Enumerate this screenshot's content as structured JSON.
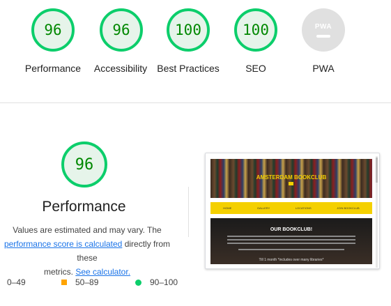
{
  "categories": [
    {
      "score": "96",
      "label": "Performance"
    },
    {
      "score": "96",
      "label": "Accessibility"
    },
    {
      "score": "100",
      "label": "Best Practices"
    },
    {
      "score": "100",
      "label": "SEO"
    },
    {
      "label": "PWA",
      "badge": "PWA"
    }
  ],
  "performance": {
    "score": "96",
    "title": "Performance",
    "desc_line1": "Values are estimated and may vary. The",
    "desc_link1": "performance score is calculated",
    "desc_mid": " directly from these",
    "desc_line3a": "metrics. ",
    "desc_link2": "See calculator."
  },
  "legend": [
    {
      "range": "0–49",
      "color": "#ff4e42"
    },
    {
      "range": "50–89",
      "color": "#ffa400"
    },
    {
      "range": "90–100",
      "color": "#0cce6b"
    }
  ],
  "screenshot": {
    "hero_title": "AMSTERDAM BOOKCLUB",
    "nav": [
      "HOME",
      "GALLERY",
      "LOCATIONS",
      "JOIN BOOKCLUB"
    ],
    "about_title": "OUR BOOKCLUB!",
    "about_footer": "Till 1 month *includes over many libraries*"
  },
  "colors": {
    "pass": "#0cce6b",
    "pass_bg": "#e6f4ea",
    "pass_text": "#008800",
    "link": "#1a73e8"
  }
}
